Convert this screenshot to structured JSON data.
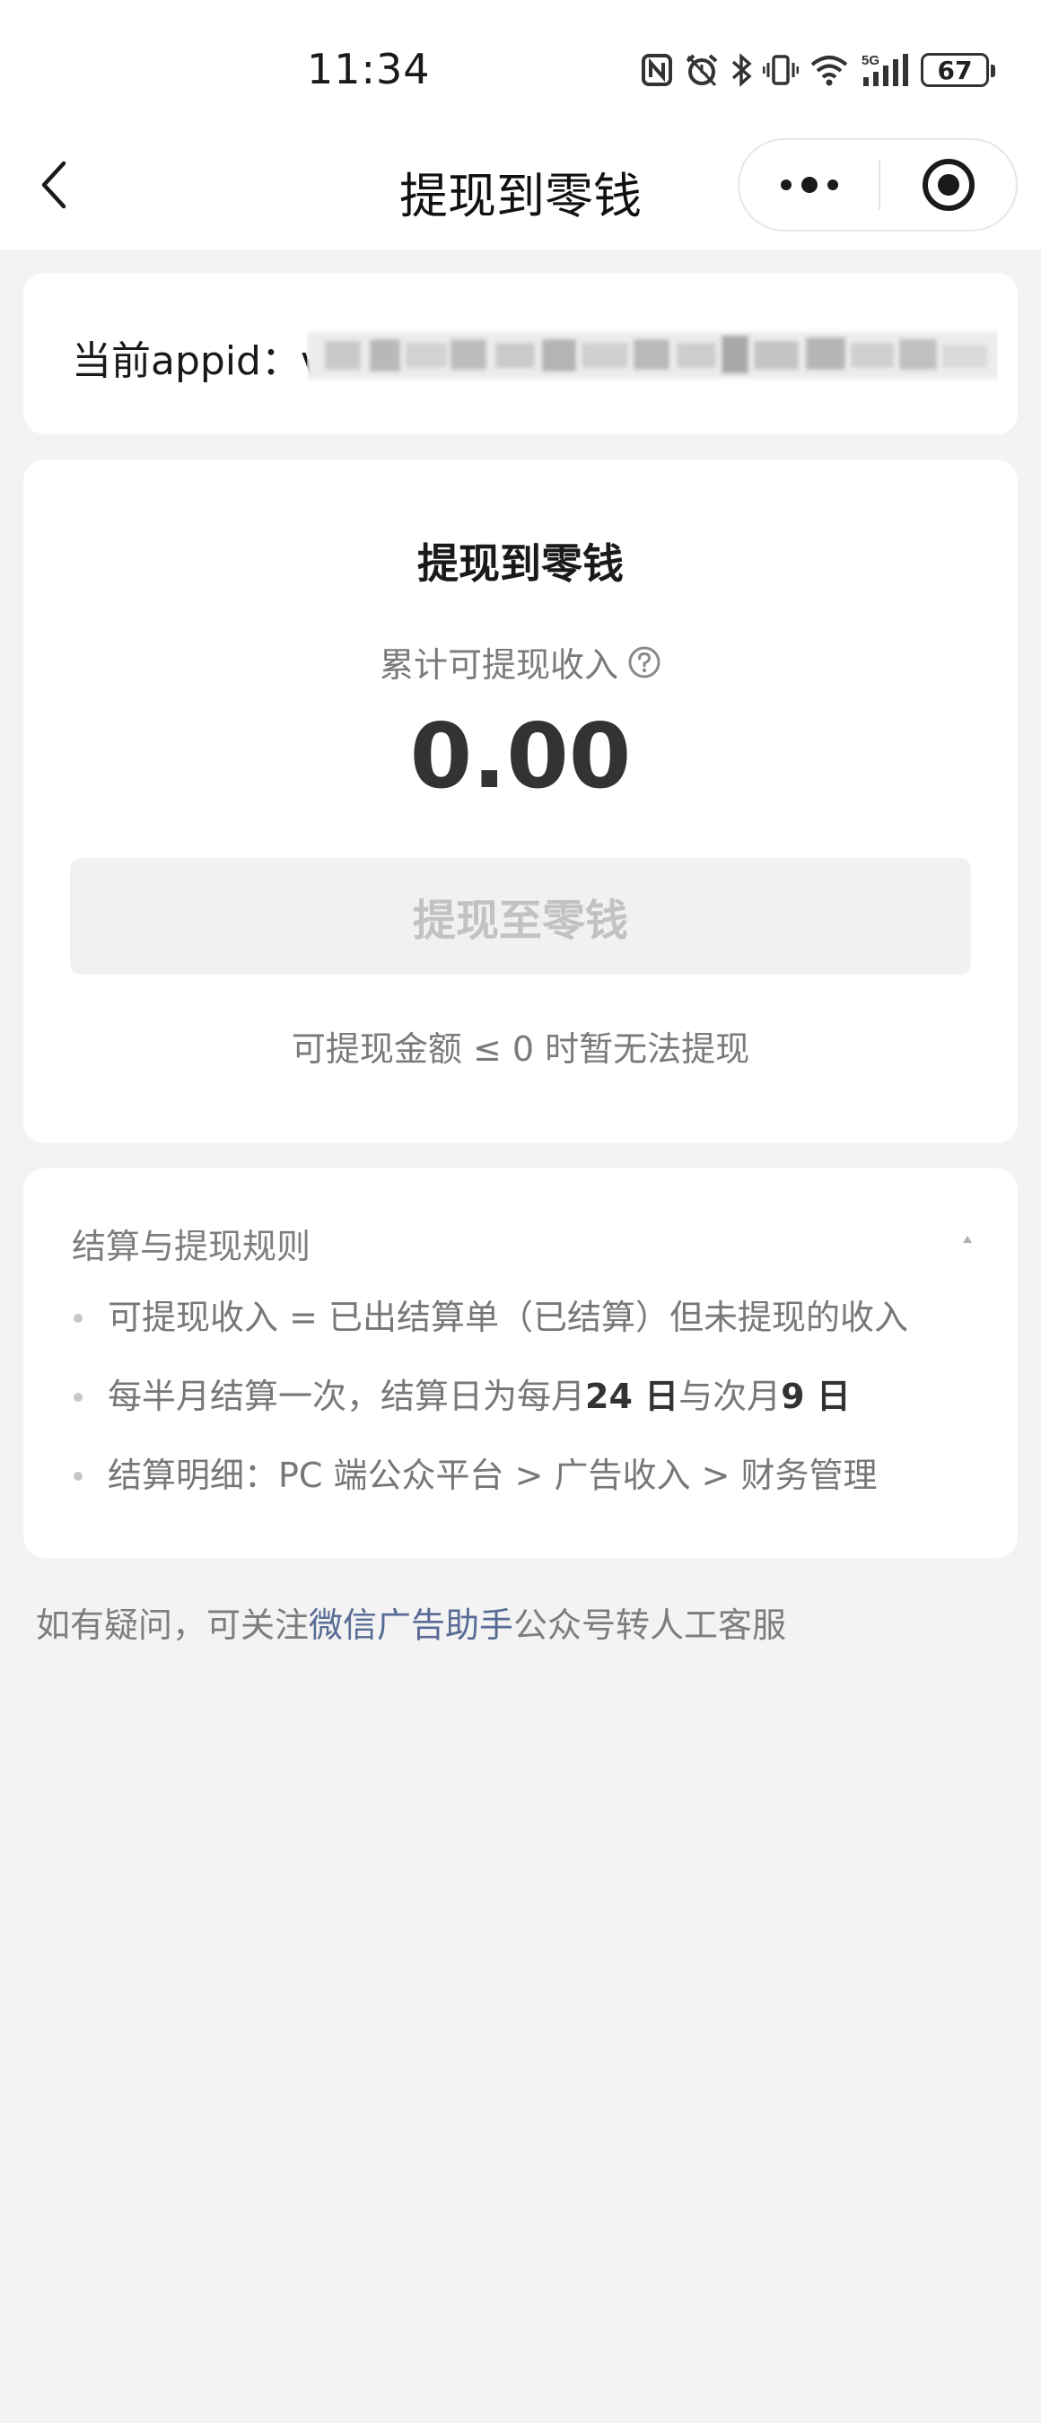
{
  "status_bar": {
    "time": "11:34",
    "battery": "67",
    "network": "5G",
    "icons": [
      "nfc-icon",
      "alarm-icon",
      "bluetooth-icon",
      "vibrate-icon",
      "wifi-icon",
      "signal-icon",
      "battery-icon"
    ]
  },
  "nav": {
    "title": "提现到零钱",
    "back_icon": "chevron-left-icon",
    "more_icon": "more-dots-icon",
    "close_icon": "target-circle-icon"
  },
  "appid": {
    "label": "当前appid：",
    "value_first_char": "v"
  },
  "withdraw": {
    "title": "提现到零钱",
    "income_label": "累计可提现收入",
    "amount": "0.00",
    "button_label": "提现至零钱",
    "note": "可提现金额 ≤ 0 时暂无法提现"
  },
  "rules": {
    "title": "结算与提现规则",
    "items": [
      {
        "text": "可提现收入 = 已出结算单（已结算）但未提现的收入"
      },
      {
        "pre": "每半月结算一次，结算日为每月",
        "day1": "24 日",
        "mid": "与次月",
        "day2": "9 日"
      },
      {
        "text": "结算明细：PC 端公众平台 > 广告收入 > 财务管理"
      }
    ]
  },
  "footer": {
    "pre": "如有疑问，可关注",
    "link": "微信广告助手",
    "post": "公众号转人工客服"
  },
  "colors": {
    "background": "#f3f3f3",
    "card": "#ffffff",
    "link": "#576b95",
    "disabled_button_bg": "#f1f1f1",
    "disabled_button_text": "#c2c2c2"
  }
}
